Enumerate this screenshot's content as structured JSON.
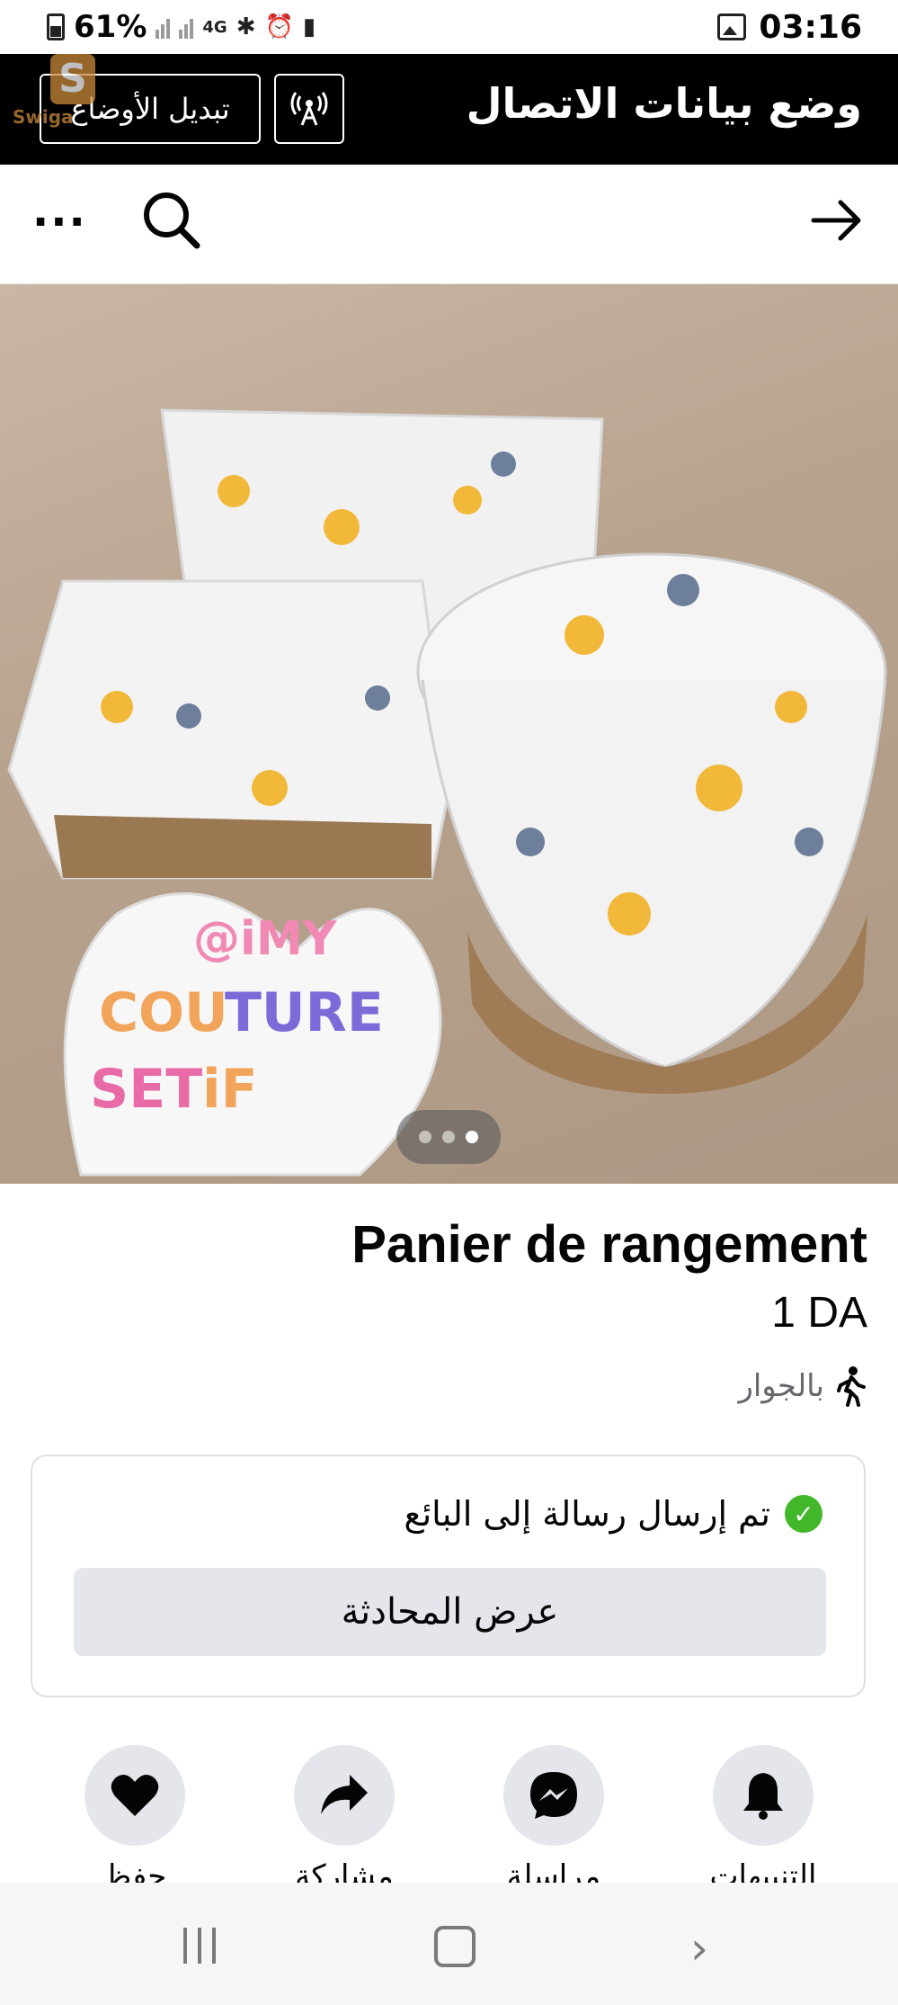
{
  "status_bar": {
    "battery": "61%",
    "network": "4G",
    "time": "03:16"
  },
  "banner": {
    "title": "وضع بيانات الاتصال",
    "switch_label": "تبديل الأوضاع",
    "watermark_text": "Swiga"
  },
  "listing": {
    "title": "Panier de rangement",
    "price": "1 DA",
    "location": "بالجوار",
    "photo_count": 3,
    "active_photo": 3
  },
  "message_card": {
    "sent_text": "تم إرسال رسالة إلى البائع",
    "view_button": "عرض المحادثة"
  },
  "actions": [
    {
      "icon": "heart-icon",
      "label": "حفظ"
    },
    {
      "icon": "share-icon",
      "label": "مشاركة"
    },
    {
      "icon": "messenger-icon",
      "label": "مراسلة"
    },
    {
      "icon": "bell-icon",
      "label": "التنبيهات"
    }
  ],
  "colors": {
    "banner_bg": "#000000",
    "check_green": "#42b72a",
    "button_gray": "#e4e6eb"
  }
}
